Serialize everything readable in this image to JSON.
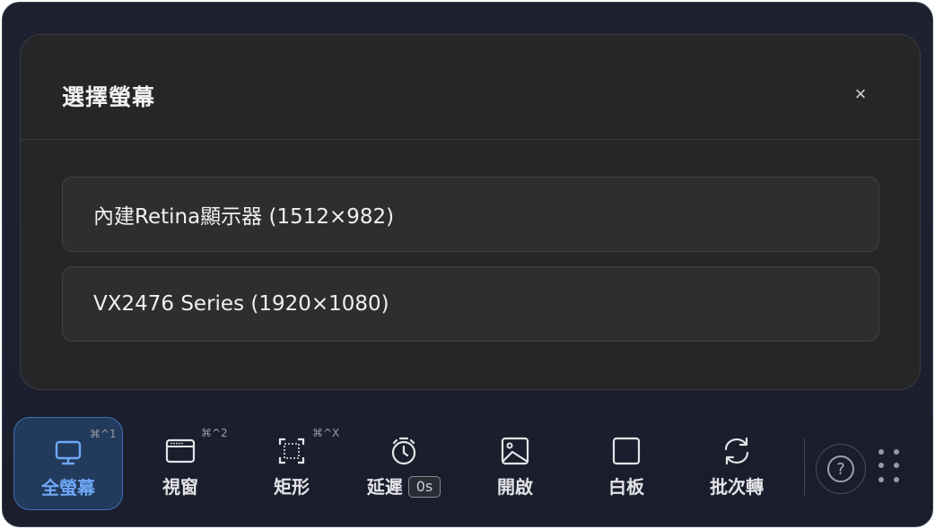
{
  "dialog": {
    "title": "選擇螢幕",
    "close_glyph": "×",
    "screens": [
      {
        "label": "內建Retina顯示器 (1512×982)"
      },
      {
        "label": "VX2476 Series (1920×1080)"
      }
    ]
  },
  "toolbar": {
    "tools": [
      {
        "id": "fullscreen",
        "label": "全螢幕",
        "shortcut": "⌘^1",
        "icon": "monitor-icon",
        "active": true
      },
      {
        "id": "window",
        "label": "視窗",
        "shortcut": "⌘^2",
        "icon": "window-icon",
        "active": false
      },
      {
        "id": "rectangle",
        "label": "矩形",
        "shortcut": "⌘^X",
        "icon": "crop-rectangle-icon",
        "active": false
      },
      {
        "id": "delay",
        "label": "延遲",
        "delay_value": "0s",
        "icon": "timer-icon",
        "active": false
      },
      {
        "id": "open",
        "label": "開啟",
        "icon": "image-icon",
        "active": false
      },
      {
        "id": "whiteboard",
        "label": "白板",
        "icon": "square-icon",
        "active": false
      },
      {
        "id": "batch",
        "label": "批次轉",
        "icon": "refresh-icon",
        "active": false
      }
    ],
    "help_glyph": "?"
  },
  "colors": {
    "accent": "#6ea8f5",
    "active_bg": "#223a5c",
    "panel_bg": "#262628",
    "window_bg": "#1e2230"
  }
}
